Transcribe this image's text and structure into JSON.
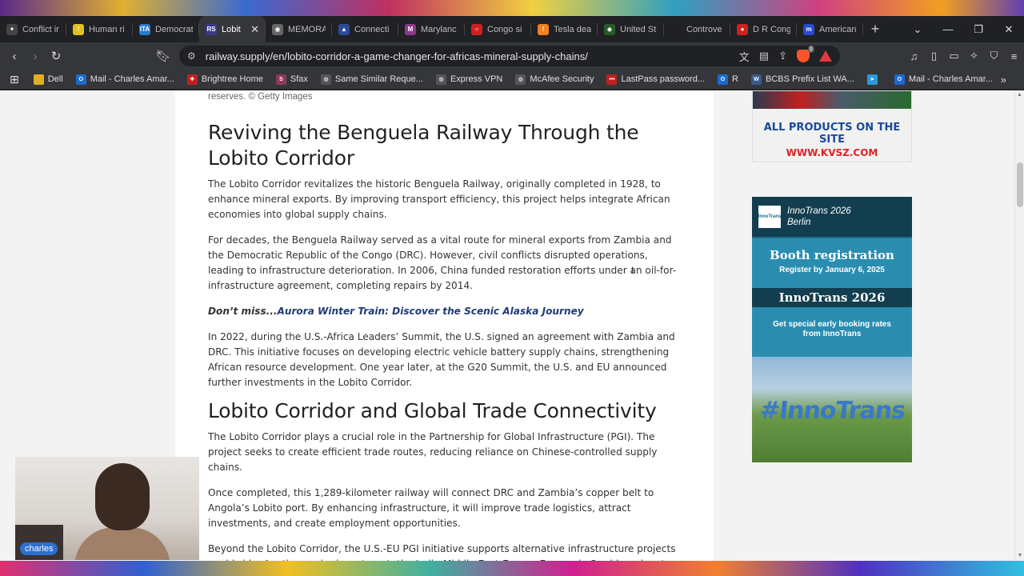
{
  "browser": {
    "tabs": [
      {
        "title": "Conflict ir",
        "fav_color": "#444444",
        "fav_text": "✦"
      },
      {
        "title": "Human ri",
        "fav_color": "#e0c020",
        "fav_text": "!"
      },
      {
        "title": "Democrat",
        "fav_color": "#2a7ad0",
        "fav_text": "ITA"
      },
      {
        "title": "Lobit",
        "fav_color": "#3a3a8a",
        "fav_text": "RS"
      },
      {
        "title": "MEMORA",
        "fav_color": "#666666",
        "fav_text": "◉"
      },
      {
        "title": "Connecti",
        "fav_color": "#2a4a9a",
        "fav_text": "▲"
      },
      {
        "title": "Marylanc",
        "fav_color": "#8a3a8a",
        "fav_text": "M"
      },
      {
        "title": "Congo si",
        "fav_color": "#d02020",
        "fav_text": "○"
      },
      {
        "title": "Tesla dea",
        "fav_color": "#f08020",
        "fav_text": "!"
      },
      {
        "title": "United St",
        "fav_color": "#2a5a2a",
        "fav_text": "◆"
      },
      {
        "title": "Controve",
        "fav_color": "#202124",
        "fav_text": ""
      },
      {
        "title": "D R Cong",
        "fav_color": "#d02020",
        "fav_text": "●"
      },
      {
        "title": "American",
        "fav_color": "#2a4ad0",
        "fav_text": "m"
      }
    ],
    "active_tab_index": 3,
    "url": "railway.supply/en/lobito-corridor-a-game-changer-for-africas-mineral-supply-chains/",
    "shield_count": "9"
  },
  "bookmarks": [
    {
      "label": "Dell",
      "color": "#e0b020",
      "icon": "folder-icon",
      "text": ""
    },
    {
      "label": "Mail - Charles Amar...",
      "color": "#1a6ad0",
      "icon": "outlook-icon",
      "text": "O"
    },
    {
      "label": "Brightree Home",
      "color": "#c02020",
      "icon": "brightree-icon",
      "text": "✚"
    },
    {
      "label": "Sfax",
      "color": "#8a3a5a",
      "icon": "sfax-icon",
      "text": "S"
    },
    {
      "label": "Same Similar Reque...",
      "color": "#555555",
      "icon": "globe-icon",
      "text": "◍"
    },
    {
      "label": "Express VPN",
      "color": "#555555",
      "icon": "globe-icon",
      "text": "◍"
    },
    {
      "label": "McAfee Security",
      "color": "#555555",
      "icon": "globe-icon",
      "text": "◍"
    },
    {
      "label": "LastPass password...",
      "color": "#c02020",
      "icon": "lastpass-icon",
      "text": "•••"
    },
    {
      "label": "R",
      "color": "#1a6ad0",
      "icon": "outlook-icon",
      "text": "O"
    },
    {
      "label": "BCBS Prefix List WA...",
      "color": "#3a5a8a",
      "icon": "wordpress-icon",
      "text": "W"
    },
    {
      "label": "",
      "color": "#2a9ad8",
      "icon": "telegram-icon",
      "text": "➤"
    },
    {
      "label": "Mail - Charles Amar...",
      "color": "#1a6ad0",
      "icon": "outlook-icon",
      "text": "O"
    }
  ],
  "article": {
    "caption": "reserves. © Getty Images",
    "heading1": "Reviving the Benguela Railway Through the Lobito Corridor",
    "p1": "The Lobito Corridor revitalizes the historic Benguela Railway, originally completed in 1928, to enhance mineral exports. By improving transport efficiency, this project helps integrate African economies into global supply chains.",
    "p2": "For decades, the Benguela Railway served as a vital route for mineral exports from Zambia and the Democratic Republic of the Congo (DRC). However, civil conflicts disrupted operations, leading to infrastructure deterioration. In 2006, China funded restoration efforts under an oil-for-infrastructure agreement, completing repairs by 2014.",
    "dont_miss_prefix": "Don’t miss...",
    "dont_miss_link": "Aurora Winter Train: Discover the Scenic Alaska Journey",
    "p3": "In 2022, during the U.S.-Africa Leaders’ Summit, the U.S. signed an agreement with Zambia and DRC. This initiative focuses on developing electric vehicle battery supply chains, strengthening African resource development. One year later, at the G20 Summit, the U.S. and EU announced further investments in the Lobito Corridor.",
    "heading2": "Lobito Corridor and Global Trade Connectivity",
    "p4": "The Lobito Corridor plays a crucial role in the Partnership for Global Infrastructure (PGI). The project seeks to create efficient trade routes, reducing reliance on Chinese-controlled supply chains.",
    "p5": "Once completed, this 1,289-kilometer railway will connect DRC and Zambia’s copper belt to Angola’s Lobito port. By enhancing infrastructure, it will improve trade logistics, attract investments, and create employment opportunities.",
    "p6": "Beyond the Lobito Corridor, the U.S.-EU PGI initiative supports alternative infrastructure projects worldwide. Another major investment, the India-Middle East-Europe Economic Corridor, aims to"
  },
  "ads": {
    "ad1_line1": "ALL PRODUCTS ON THE SITE",
    "ad1_line2": "WWW.KVSZ.COM",
    "ad2_logo": "InnoTrans",
    "ad2_head": "InnoTrans 2026\nBerlin",
    "ad2_head_l1": "InnoTrans 2026",
    "ad2_head_l2": "Berlin",
    "ad2_b1_title": "Booth registration",
    "ad2_b1_sub": "Register by January 6, 2025",
    "ad2_b2": "InnoTrans 2026",
    "ad2_b3_l1": "Get special early booking rates",
    "ad2_b3_l2": "from InnoTrans",
    "ad2_photo_text": "#InnoTrans"
  },
  "webcam": {
    "name": "charles"
  }
}
